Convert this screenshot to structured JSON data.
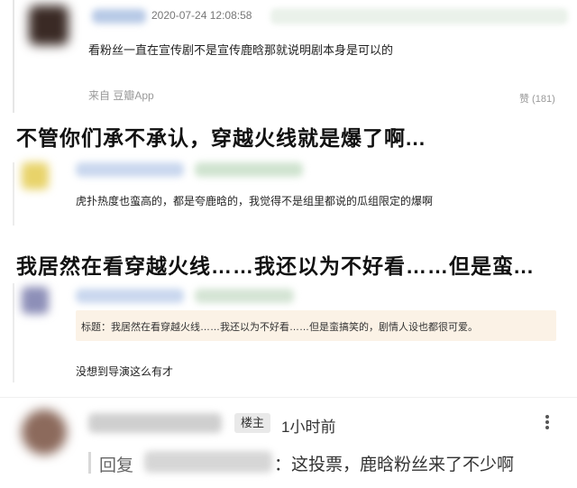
{
  "card1": {
    "timestamp": "2020-07-24 12:08:58",
    "body": "看粉丝一直在宣传剧不是宣传鹿晗那就说明剧本身是可以的",
    "source": "来自 豆瓣App",
    "like": "赞 (181)"
  },
  "headline1": "不管你们承不承认，穿越火线就是爆了啊...",
  "card2": {
    "body": "虎扑热度也蛮高的，都是夸鹿晗的，我觉得不是组里都说的瓜组限定的爆啊"
  },
  "headline2": "我居然在看穿越火线……我还以为不好看……但是蛮...",
  "card3": {
    "quote": "标题：我居然在看穿越火线……我还以为不好看……但是蛮搞笑的，剧情人设也都很可爱。",
    "body": "没想到导演这么有才"
  },
  "card4": {
    "badge": "楼主",
    "time": "1小时前",
    "reply_label": "回复",
    "reply_text": "：这投票，鹿晗粉丝来了不少啊"
  },
  "icons": {
    "more": "more-vertical-icon"
  }
}
